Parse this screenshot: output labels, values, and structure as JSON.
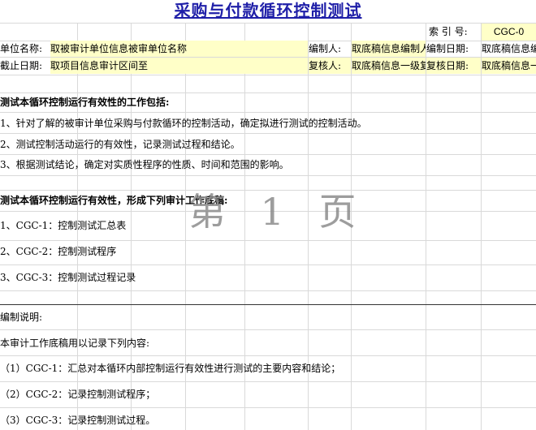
{
  "title": "采购与付款循环控制测试",
  "index": {
    "label": "索 引 号:",
    "value": "CGC-0"
  },
  "header_rows": [
    {
      "left_label": "单位名称:",
      "left_value": "取被审计单位信息被审单位名称",
      "mid_label": "编制人:",
      "mid_value": "取底稿信息编制人",
      "right_label": "编制日期:",
      "right_value": "取底稿信息编制日期"
    },
    {
      "left_label": "截止日期:",
      "left_value": "取项目信息审计区间至",
      "mid_label": "复核人:",
      "mid_value": "取底稿信息一级复核人",
      "right_label": "复核日期:",
      "right_value": "取底稿信息一级复核日期"
    }
  ],
  "section1": {
    "heading": "测试本循环控制运行有效性的工作包括:",
    "items": [
      "1、针对了解的被审计单位采购与付款循环的控制活动，确定拟进行测试的控制活动。",
      "2、测试控制活动运行的有效性，记录测试过程和结论。",
      "3、根据测试结论，确定对实质性程序的性质、时间和范围的影响。"
    ]
  },
  "section2": {
    "heading": "测试本循环控制运行有效性，形成下列审计工作底稿:",
    "items": [
      "1、CGC-1：控制测试汇总表",
      "2、CGC-2：控制测试程序",
      "3、CGC-3：控制测试过程记录"
    ]
  },
  "watermark": "第 1 页",
  "notes": {
    "heading": "编制说明:",
    "intro": "本审计工作底稿用以记录下列内容:",
    "items": [
      "（1）CGC-1：汇总对本循环内部控制运行有效性进行测试的主要内容和结论；",
      "（2）CGC-2：记录控制测试程序；",
      "（3）CGC-3：记录控制测试过程。"
    ]
  }
}
